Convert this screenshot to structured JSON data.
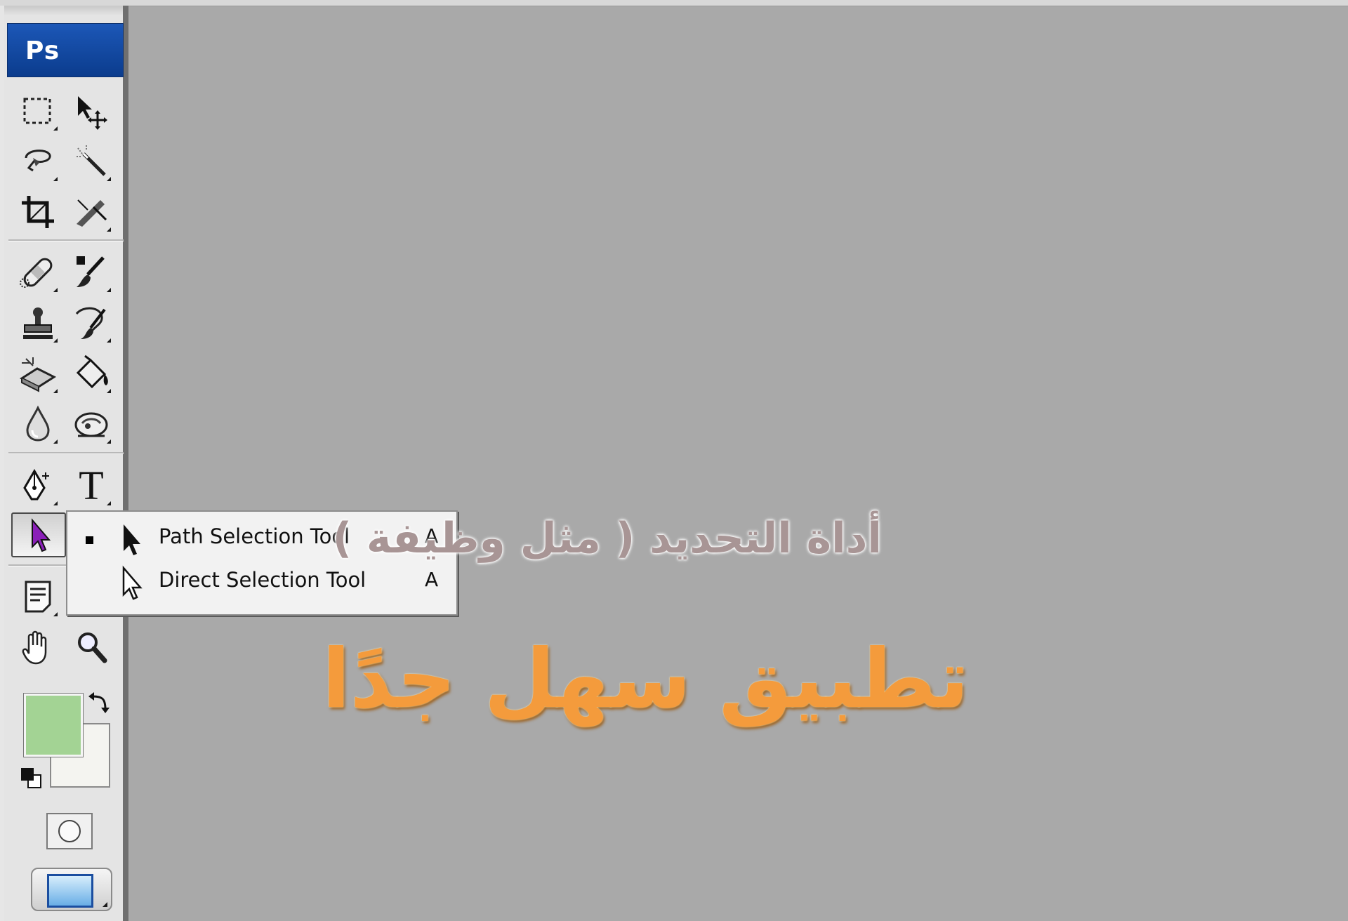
{
  "app": {
    "logo_text": "Ps"
  },
  "toolbar": {
    "tools": [
      {
        "name": "rectangular-marquee-tool",
        "icon": "dashed-rectangle-icon"
      },
      {
        "name": "move-tool",
        "icon": "move-arrow-icon"
      },
      {
        "name": "lasso-tool",
        "icon": "lasso-icon"
      },
      {
        "name": "magic-wand-tool",
        "icon": "magic-wand-icon"
      },
      {
        "name": "crop-tool",
        "icon": "crop-icon"
      },
      {
        "name": "slice-tool",
        "icon": "slice-knife-icon"
      },
      {
        "name": "healing-brush-tool",
        "icon": "bandage-icon"
      },
      {
        "name": "brush-tool",
        "icon": "brush-icon"
      },
      {
        "name": "clone-stamp-tool",
        "icon": "stamp-icon"
      },
      {
        "name": "history-brush-tool",
        "icon": "history-brush-icon"
      },
      {
        "name": "eraser-tool",
        "icon": "eraser-icon"
      },
      {
        "name": "paint-bucket-tool",
        "icon": "paint-bucket-icon"
      },
      {
        "name": "blur-tool",
        "icon": "water-drop-icon"
      },
      {
        "name": "dodge-tool",
        "icon": "dodge-icon"
      },
      {
        "name": "pen-tool",
        "icon": "pen-nib-icon"
      },
      {
        "name": "type-tool",
        "icon": "type-icon"
      },
      {
        "name": "path-selection-tool",
        "icon": "arrow-cursor-icon",
        "active": true
      },
      {
        "name": "notes-tool",
        "icon": "note-icon"
      },
      {
        "name": "hand-tool",
        "icon": "hand-icon"
      },
      {
        "name": "zoom-tool",
        "icon": "magnifier-icon"
      }
    ],
    "type_glyph": "T",
    "foreground_color": "#a3d394",
    "background_color": "#f4f4f0"
  },
  "flyout_menu": {
    "items": [
      {
        "label": "Path Selection Tool",
        "shortcut": "A",
        "selected": true,
        "icon": "black-arrow-icon"
      },
      {
        "label": "Direct Selection Tool",
        "shortcut": "A",
        "selected": false,
        "icon": "white-arrow-icon"
      }
    ]
  },
  "canvas": {
    "background_color": "#a9a9a9",
    "caption_small": "أداة التحديد ( مثل وظيفة )",
    "caption_large": "تطبيق سهل جدًا",
    "caption_small_color": "#a89595",
    "caption_large_color": "#f49b3c"
  }
}
